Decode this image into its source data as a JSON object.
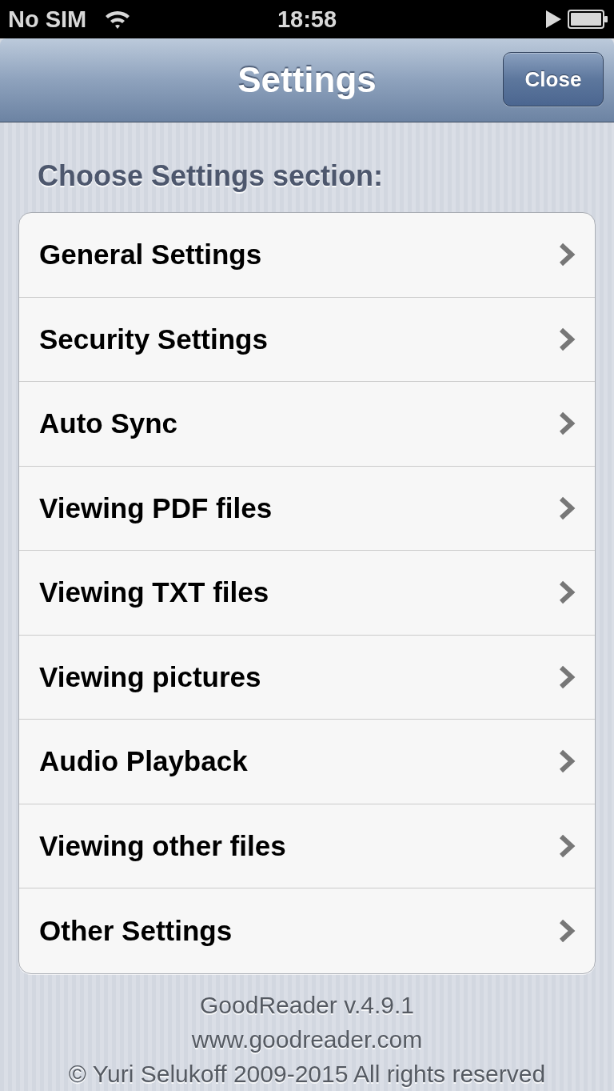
{
  "status_bar": {
    "carrier": "No SIM",
    "time": "18:58"
  },
  "nav_bar": {
    "title": "Settings",
    "close_button": "Close"
  },
  "section_header": "Choose Settings section:",
  "settings_sections": [
    {
      "label": "General Settings"
    },
    {
      "label": "Security Settings"
    },
    {
      "label": "Auto Sync"
    },
    {
      "label": "Viewing PDF files"
    },
    {
      "label": "Viewing TXT files"
    },
    {
      "label": "Viewing pictures"
    },
    {
      "label": "Audio Playback"
    },
    {
      "label": "Viewing other files"
    },
    {
      "label": "Other Settings"
    }
  ],
  "footer": [
    "GoodReader v.4.9.1",
    "www.goodreader.com",
    "© Yuri Selukoff 2009-2015 All rights reserved"
  ]
}
